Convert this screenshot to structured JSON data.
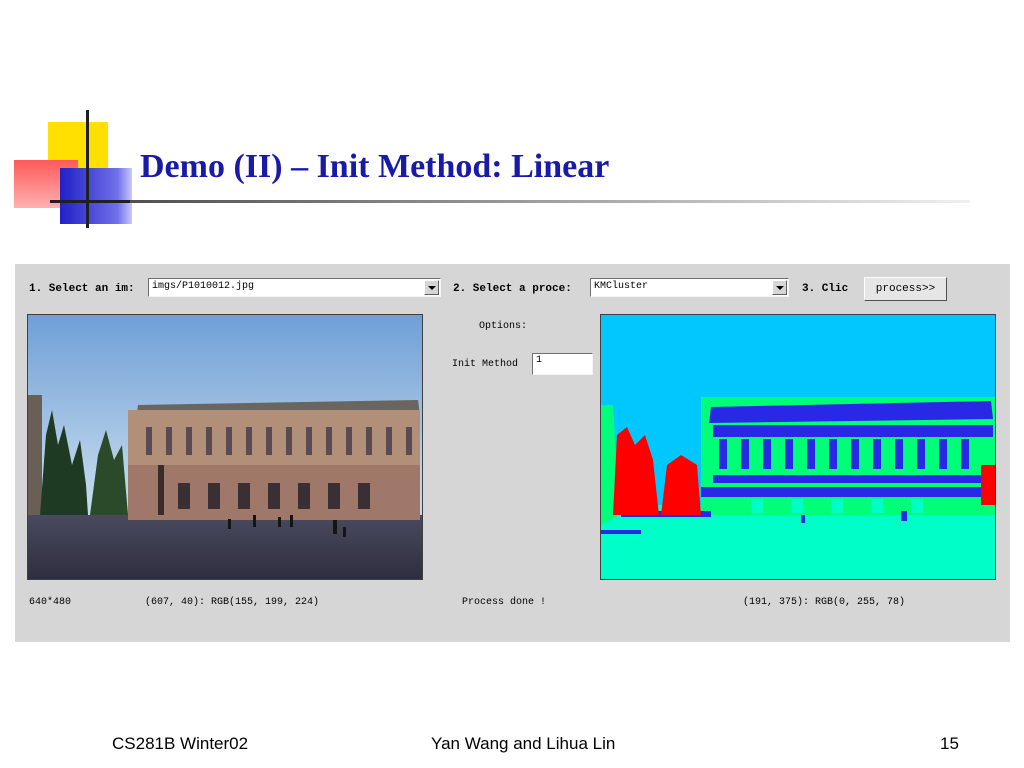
{
  "slide": {
    "title": "Demo (II) – Init Method: Linear",
    "footer_left": "CS281B Winter02",
    "footer_center": "Yan Wang and Lihua Lin",
    "page_number": "15"
  },
  "app": {
    "step1_label": "1. Select an im:",
    "image_select_value": "imgs/P1010012.jpg",
    "step2_label": "2. Select a proce:",
    "process_select_value": "KMCluster",
    "step3_label": "3. Clic",
    "process_button": "process>>",
    "options_label": "Options:",
    "init_method_label": "Init Method",
    "init_method_value": "1",
    "image_size": "640*480",
    "source_pixel_info": "(607, 40): RGB(155, 199, 224)",
    "status_text": "Process done !",
    "result_pixel_info": "(191, 375): RGB(0, 255, 78)"
  },
  "colors": {
    "title": "#1a1aa8",
    "panel": "#d6d6d6",
    "cluster_cyan": "#00c8ff",
    "cluster_green": "#00ff78",
    "cluster_blue": "#2828e6",
    "cluster_red": "#ff0000",
    "cluster_aqua": "#00ffc8"
  }
}
